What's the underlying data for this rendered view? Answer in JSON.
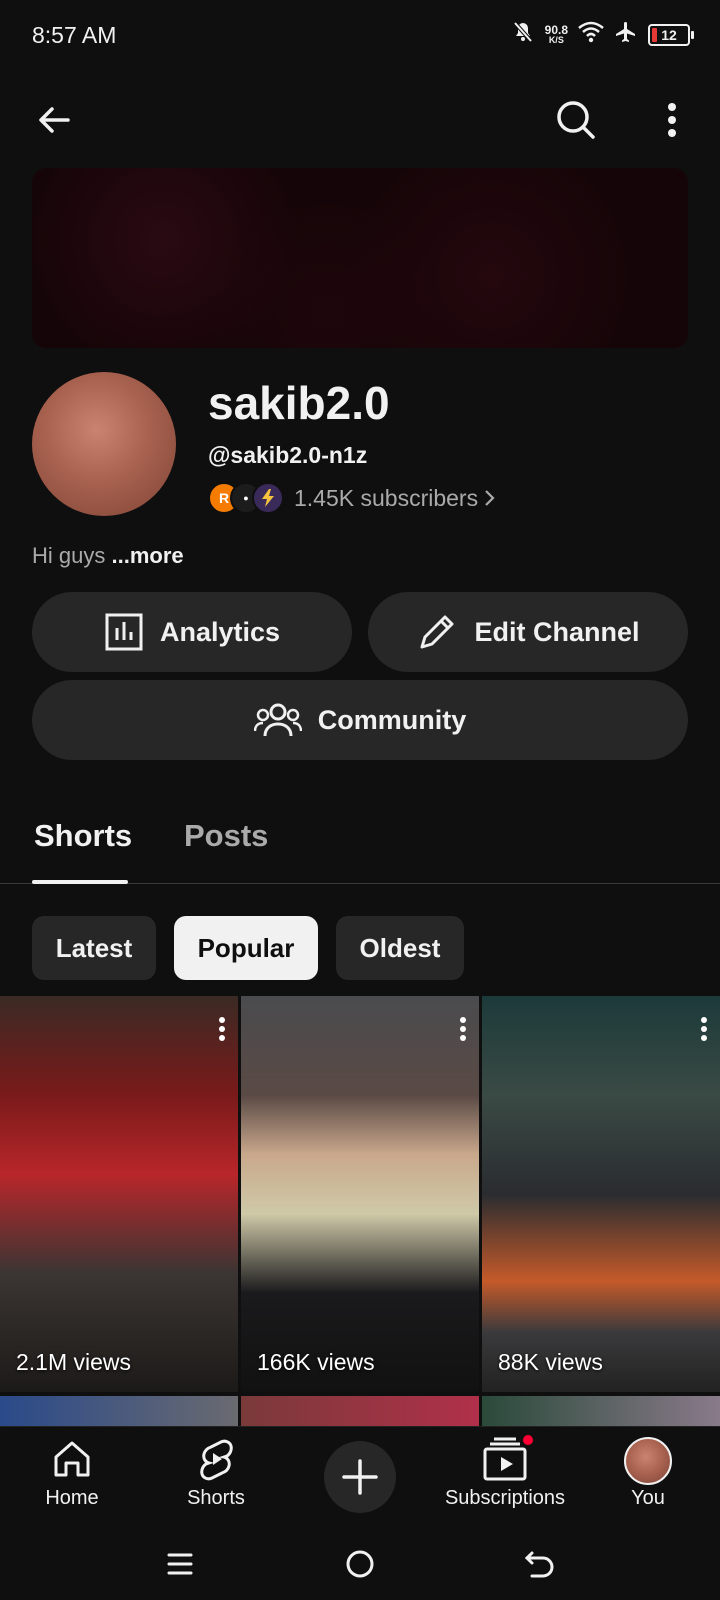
{
  "status_bar": {
    "time": "8:57 AM",
    "net_speed": "90.8",
    "net_unit": "K/S",
    "battery": "12"
  },
  "channel": {
    "name": "sakib2.0",
    "handle": "@sakib2.0-n1z",
    "subscribers": "1.45K subscribers",
    "description": "Hi guys",
    "more_label": "...more",
    "subscriber_avatars": [
      {
        "letter": "R",
        "color": "#f57c00"
      },
      {
        "letter": "",
        "color": "#1c1c1c"
      },
      {
        "letter": "",
        "color": "#3a2a5a"
      }
    ]
  },
  "buttons": {
    "analytics": "Analytics",
    "edit_channel": "Edit Channel",
    "community": "Community"
  },
  "tabs": [
    {
      "label": "Shorts",
      "active": true
    },
    {
      "label": "Posts",
      "active": false
    }
  ],
  "sort_chips": [
    {
      "label": "Latest",
      "selected": false
    },
    {
      "label": "Popular",
      "selected": true
    },
    {
      "label": "Oldest",
      "selected": false
    }
  ],
  "shorts": [
    {
      "views": "2.1M views"
    },
    {
      "views": "166K views"
    },
    {
      "views": "88K views"
    }
  ],
  "bottom_nav": [
    {
      "label": "Home",
      "icon": "home-icon"
    },
    {
      "label": "Shorts",
      "icon": "shorts-icon"
    },
    {
      "label": "",
      "icon": "add-icon"
    },
    {
      "label": "Subscriptions",
      "icon": "subscriptions-icon"
    },
    {
      "label": "You",
      "icon": "avatar"
    }
  ],
  "colors": {
    "background": "#0f0f0f",
    "surface": "#272727",
    "text": "#f1f1f1",
    "muted": "#aaaaaa",
    "badge": "#ff0033"
  }
}
